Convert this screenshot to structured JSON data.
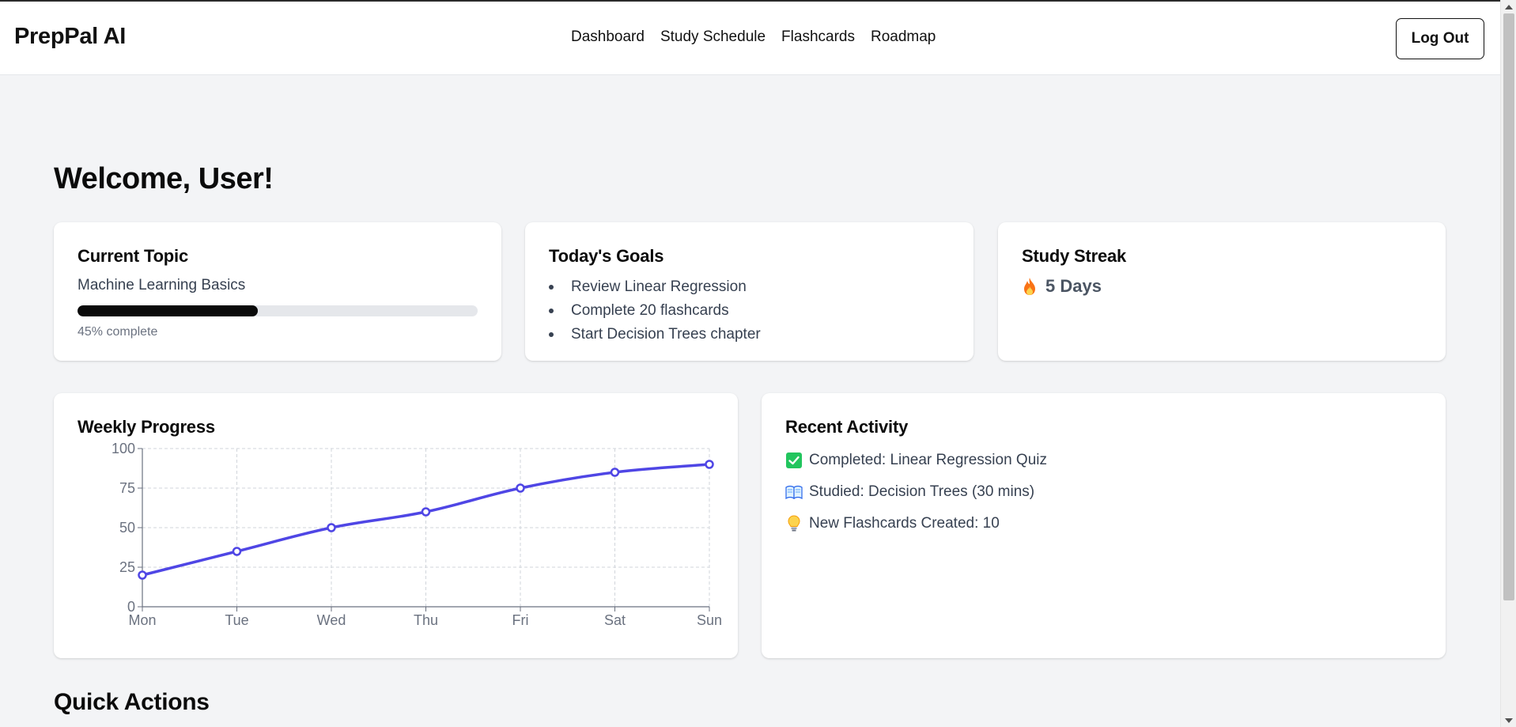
{
  "header": {
    "brand": "PrepPal AI",
    "nav": [
      "Dashboard",
      "Study Schedule",
      "Flashcards",
      "Roadmap"
    ],
    "logout_label": "Log Out"
  },
  "welcome": "Welcome, User!",
  "current_topic": {
    "title": "Current Topic",
    "topic": "Machine Learning Basics",
    "progress": 45,
    "progress_text": "45% complete"
  },
  "todays_goals": {
    "title": "Today's Goals",
    "items": [
      "Review Linear Regression",
      "Complete 20 flashcards",
      "Start Decision Trees chapter"
    ]
  },
  "study_streak": {
    "title": "Study Streak",
    "value": "5 Days",
    "icon": "fire-icon"
  },
  "weekly_progress": {
    "title": "Weekly Progress"
  },
  "chart_data": {
    "type": "line",
    "categories": [
      "Mon",
      "Tue",
      "Wed",
      "Thu",
      "Fri",
      "Sat",
      "Sun"
    ],
    "series": [
      {
        "values": [
          20,
          35,
          50,
          60,
          75,
          85,
          90
        ],
        "color": "#4f46e5"
      }
    ],
    "y_ticks": [
      0,
      25,
      50,
      75,
      100
    ],
    "ylim": [
      0,
      100
    ],
    "grid": true
  },
  "recent_activity": {
    "title": "Recent Activity",
    "items": [
      {
        "icon": "check-icon",
        "text": "Completed: Linear Regression Quiz"
      },
      {
        "icon": "book-icon",
        "text": "Studied: Decision Trees (30 mins)"
      },
      {
        "icon": "lightbulb-icon",
        "text": "New Flashcards Created: 10"
      }
    ]
  },
  "quick_actions_title": "Quick Actions",
  "colors": {
    "accent": "#4f46e5",
    "check": "#22c55e",
    "flame": "#f97316"
  }
}
